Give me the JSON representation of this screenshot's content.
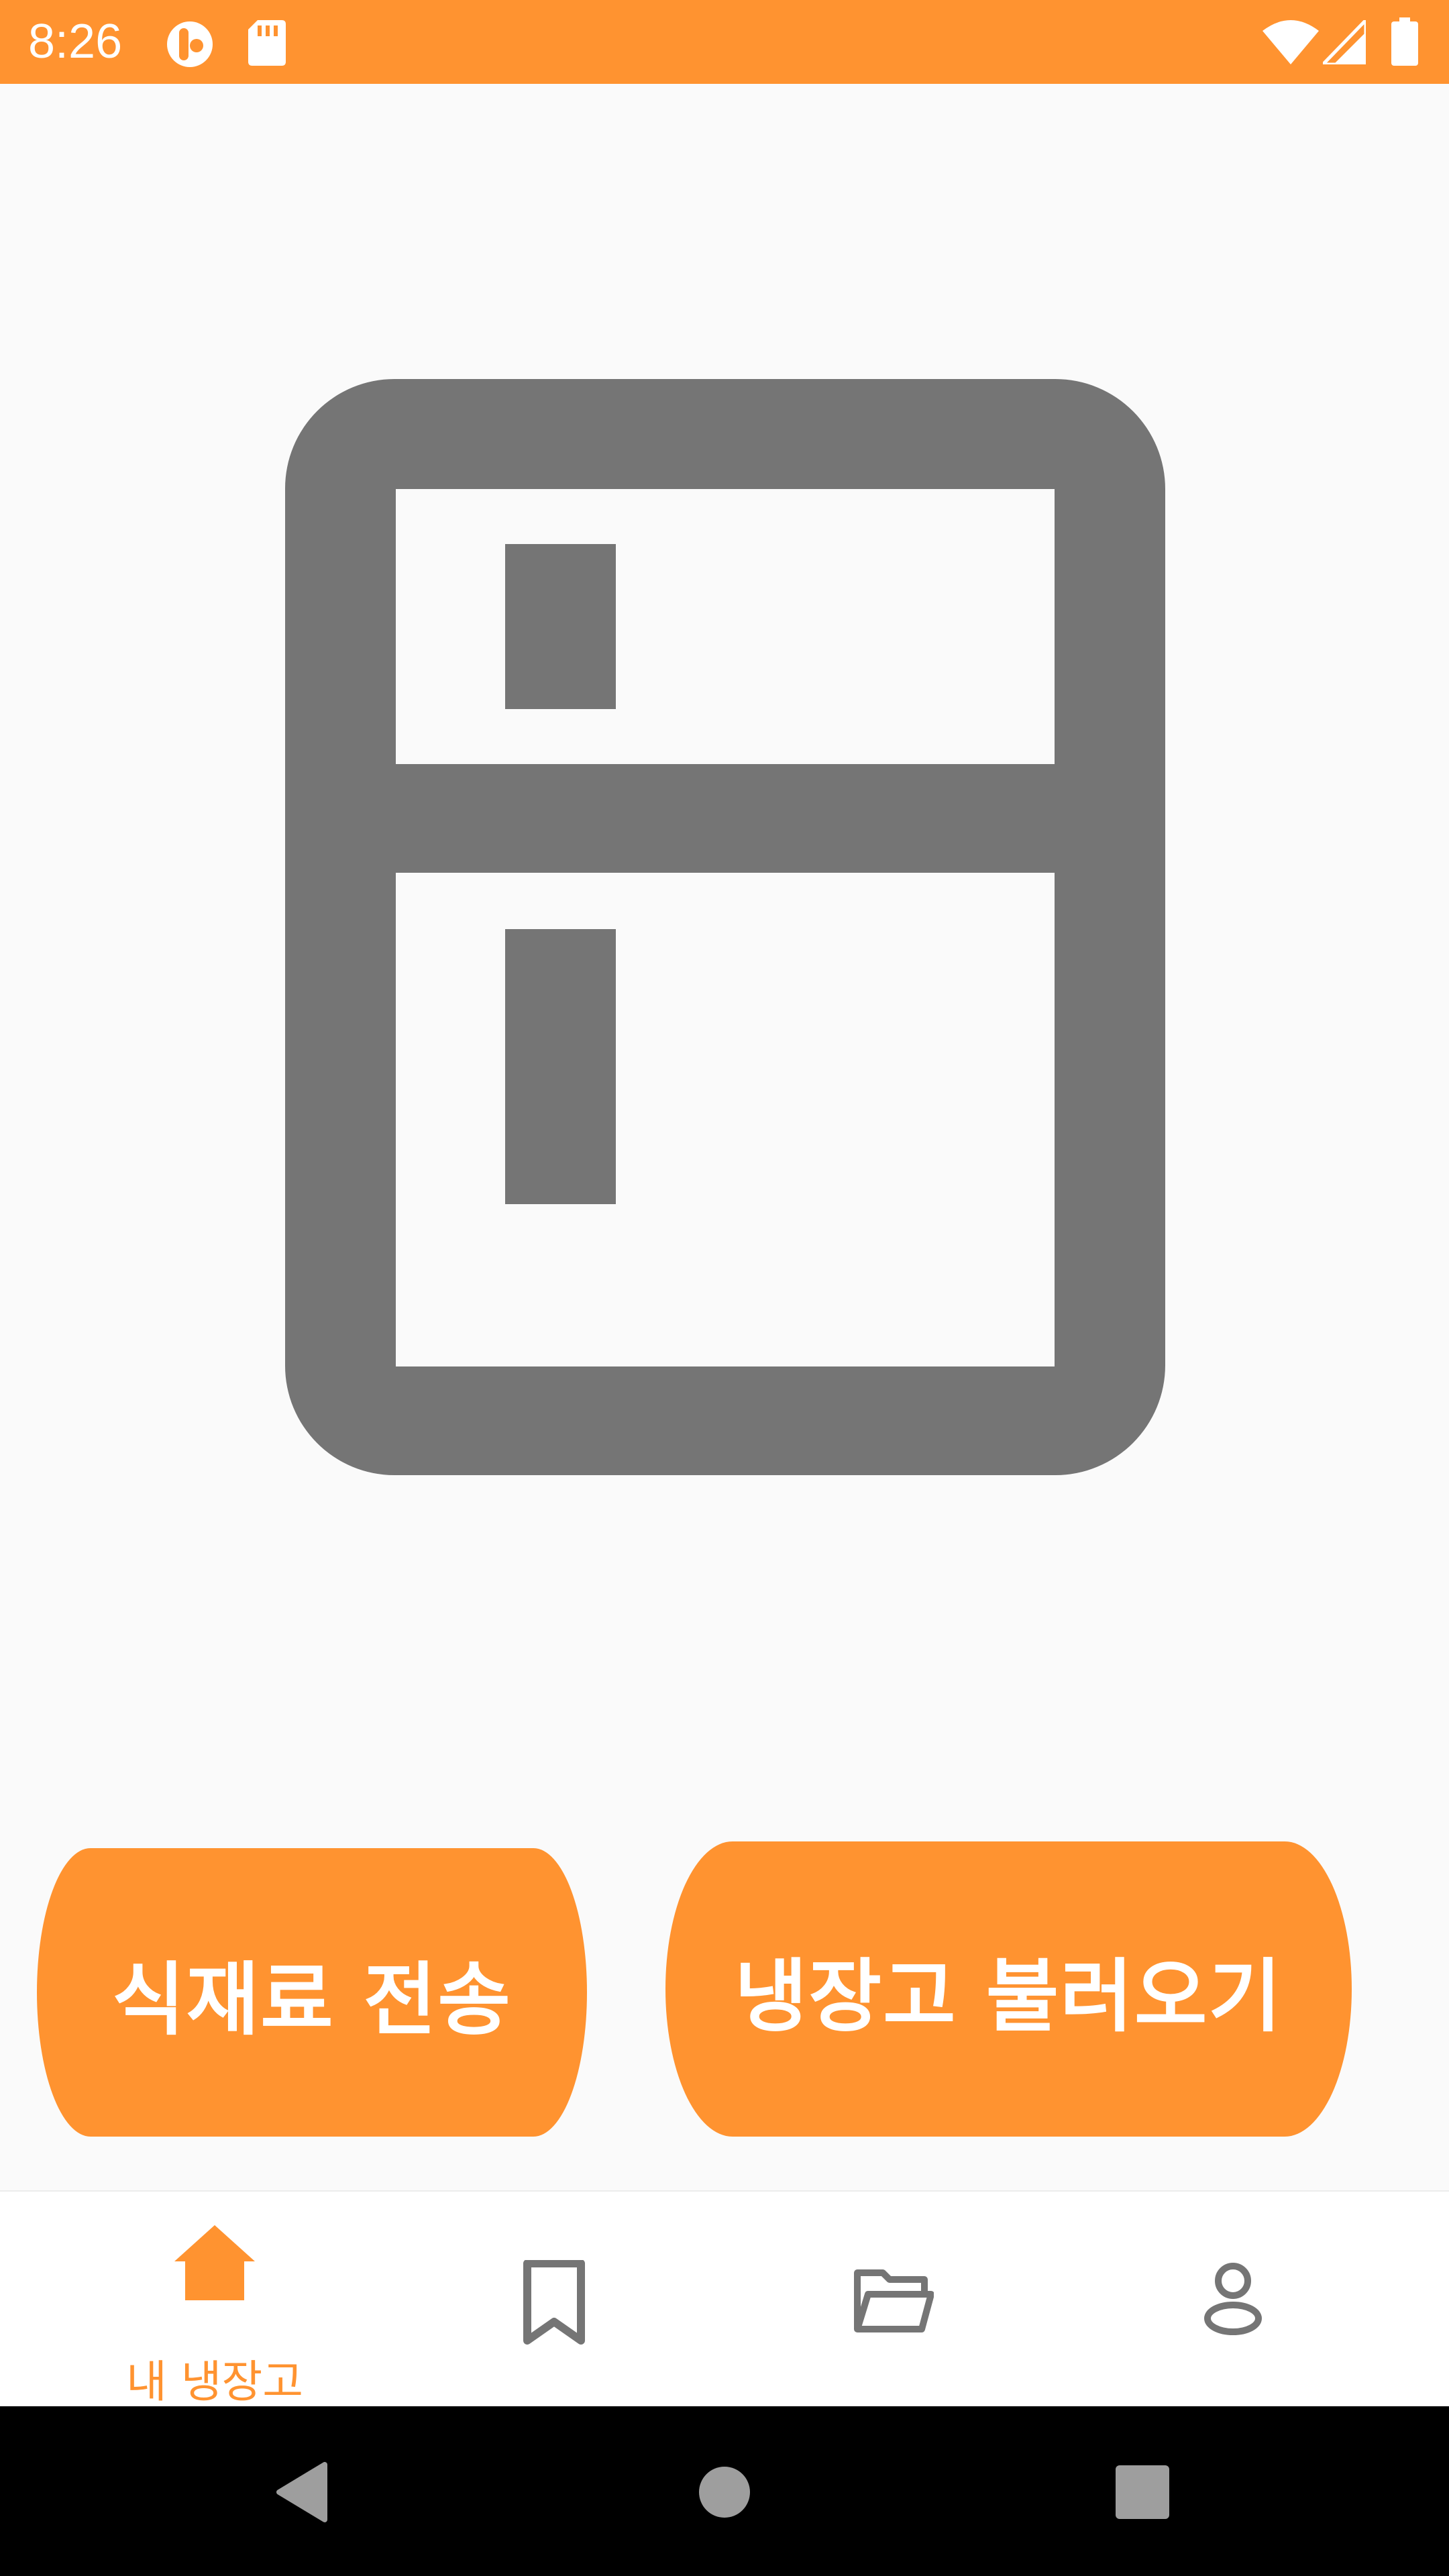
{
  "status_bar": {
    "time": "8:26",
    "background_color": "#ff9330",
    "icons_left": [
      "app-notification-icon",
      "sd-card-icon"
    ],
    "icons_right": [
      "wifi-icon",
      "cellular-signal-icon",
      "battery-icon"
    ]
  },
  "main": {
    "hero_icon": "refrigerator-icon",
    "hero_icon_color": "#757575",
    "buttons": {
      "send_ingredients_label": "식재료 전송",
      "load_fridge_label": "냉장고 불러오기"
    },
    "button_color": "#ff9330"
  },
  "bottom_nav": {
    "items": [
      {
        "label": "내 냉장고",
        "icon": "home-icon",
        "selected": true
      },
      {
        "label": "",
        "icon": "bookmark-icon",
        "selected": false
      },
      {
        "label": "",
        "icon": "folder-icon",
        "selected": false
      },
      {
        "label": "",
        "icon": "person-icon",
        "selected": false
      }
    ],
    "active_color": "#ff9330",
    "inactive_color": "#757575"
  },
  "system_nav": {
    "buttons": [
      "back-icon",
      "home-circle-icon",
      "recents-icon"
    ]
  }
}
